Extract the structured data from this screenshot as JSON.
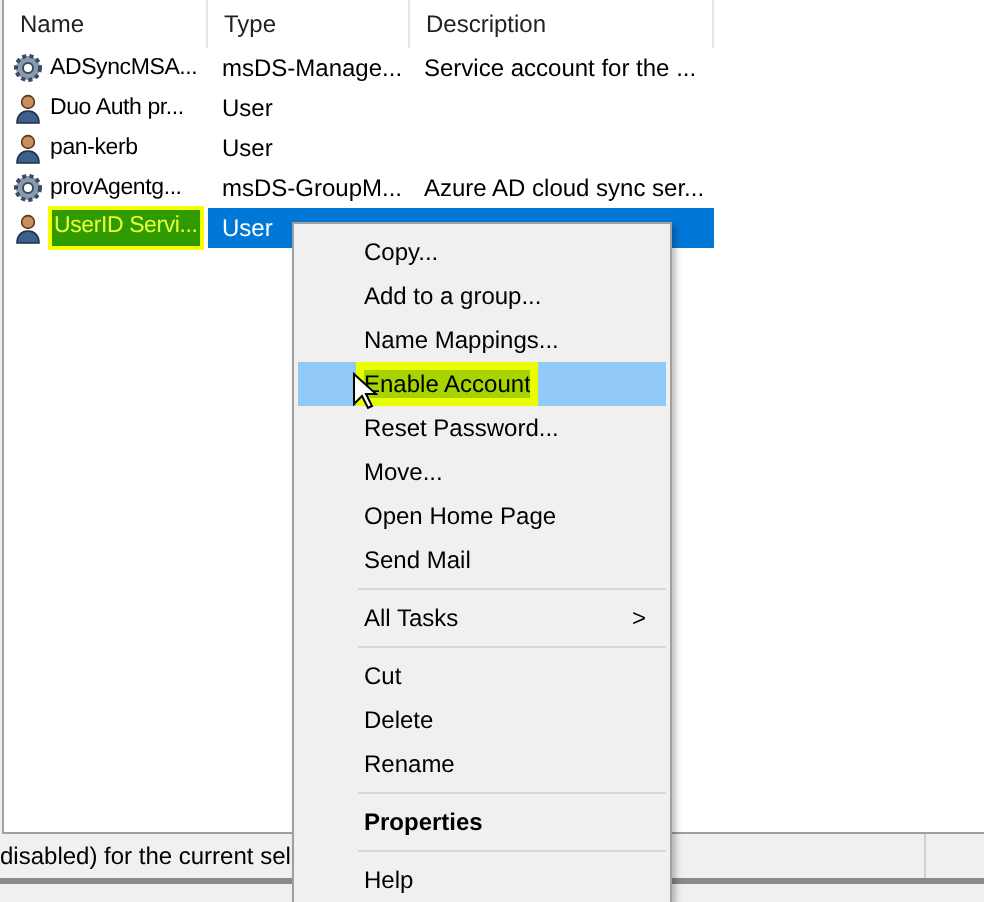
{
  "columns": [
    "Name",
    "Type",
    "Description"
  ],
  "rows": [
    {
      "kind": "service",
      "name": "ADSyncMSA...",
      "type": "msDS-Manage...",
      "description": "Service account for the ...",
      "selected": false,
      "marked": false
    },
    {
      "kind": "user",
      "name": "Duo Auth pr...",
      "type": "User",
      "selected": false,
      "marked": false
    },
    {
      "kind": "user",
      "name": "pan-kerb",
      "type": "User",
      "selected": false,
      "marked": false
    },
    {
      "kind": "service",
      "name": "provAgentg...",
      "type": "msDS-GroupM...",
      "description": "Azure AD cloud sync ser...",
      "selected": false,
      "marked": false
    },
    {
      "kind": "user",
      "name": "UserID Servi...",
      "type": "User",
      "selected": true,
      "marked": true
    }
  ],
  "context_menu": [
    {
      "kind": "item",
      "label": "Copy...",
      "selected": false,
      "marked": false
    },
    {
      "kind": "item",
      "label": "Add to a group...",
      "selected": false,
      "marked": false
    },
    {
      "kind": "item",
      "label": "Name Mappings...",
      "selected": false,
      "marked": false
    },
    {
      "kind": "item",
      "label": "Enable Account",
      "selected": true,
      "marked": true
    },
    {
      "kind": "item",
      "label": "Reset Password...",
      "selected": false,
      "marked": false
    },
    {
      "kind": "item",
      "label": "Move...",
      "selected": false,
      "marked": false
    },
    {
      "kind": "item",
      "label": "Open Home Page",
      "selected": false,
      "marked": false
    },
    {
      "kind": "item",
      "label": "Send Mail",
      "selected": false,
      "marked": false
    },
    {
      "kind": "separator"
    },
    {
      "kind": "submenu",
      "label": "All Tasks",
      "arrow": ">",
      "selected": false,
      "marked": false
    },
    {
      "kind": "separator"
    },
    {
      "kind": "item",
      "label": "Cut",
      "selected": false,
      "marked": false
    },
    {
      "kind": "item",
      "label": "Delete",
      "selected": false,
      "marked": false
    },
    {
      "kind": "item",
      "label": "Rename",
      "selected": false,
      "marked": false
    },
    {
      "kind": "separator"
    },
    {
      "kind": "default",
      "label": "Properties",
      "selected": false,
      "marked": false
    },
    {
      "kind": "separator"
    },
    {
      "kind": "item",
      "label": "Help",
      "selected": false,
      "marked": false
    }
  ],
  "status_bar": {
    "text": "disabled) for the current sel"
  }
}
